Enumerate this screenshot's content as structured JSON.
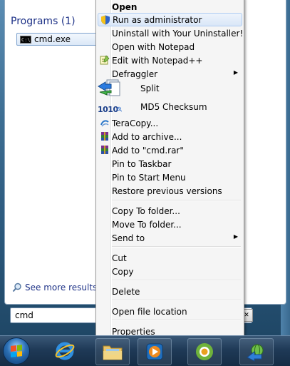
{
  "start_menu": {
    "section_title": "Programs (1)",
    "program_item": "cmd.exe",
    "program_icon_text": "C:\\.",
    "see_more": "See more results",
    "search_value": "cmd"
  },
  "context_menu": {
    "items": [
      {
        "label": "Open",
        "bold": true
      },
      {
        "label": "Run as administrator",
        "icon": "shield-icon"
      },
      {
        "label": "Uninstall with Your Uninstaller!"
      },
      {
        "label": "Open with Notepad"
      },
      {
        "label": "Edit with Notepad++",
        "icon": "notepadpp-icon"
      },
      {
        "label": "Defraggler",
        "submenu": true
      },
      {
        "label": "Split",
        "icon": "split-icon"
      },
      {
        "label": "MD5 Checksum",
        "icon": "md5-icon"
      },
      {
        "label": "TeraCopy...",
        "icon": "teracopy-icon"
      },
      {
        "label": "Add to archive...",
        "icon": "winrar-icon"
      },
      {
        "label": "Add to \"cmd.rar\"",
        "icon": "winrar-icon"
      },
      {
        "label": "Pin to Taskbar"
      },
      {
        "label": "Pin to Start Menu"
      },
      {
        "label": "Restore previous versions"
      },
      {
        "label": "Copy To folder..."
      },
      {
        "label": "Move To folder..."
      },
      {
        "label": "Send to",
        "submenu": true
      },
      {
        "label": "Cut"
      },
      {
        "label": "Copy"
      },
      {
        "label": "Delete"
      },
      {
        "label": "Open file location"
      },
      {
        "label": "Properties"
      }
    ],
    "md5_icon_text": "1010",
    "submenu_arrow": "▶"
  },
  "taskbar": {
    "items": [
      "start-orb",
      "internet-explorer-icon",
      "windows-explorer-icon",
      "media-player-icon",
      "chrome-icon",
      "network-app-icon"
    ]
  },
  "colors": {
    "highlight_border": "#aeccf1",
    "title_blue": "#1e3287"
  }
}
